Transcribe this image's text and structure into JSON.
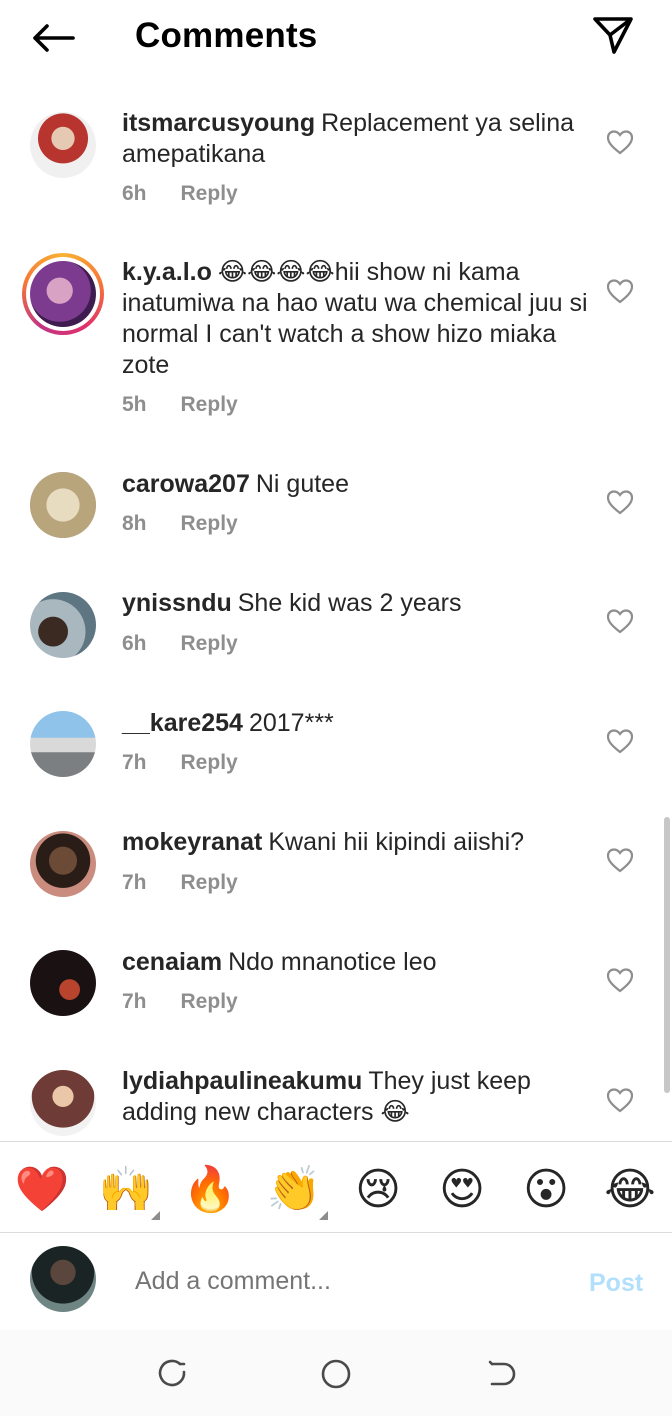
{
  "header": {
    "title": "Comments",
    "back_icon": "arrow-left-icon",
    "share_icon": "paper-plane-icon"
  },
  "comments": [
    {
      "username": "itsmarcusyoung",
      "text": "Replacement ya selina amepatikana",
      "time": "6h",
      "reply_label": "Reply",
      "avatar_color": "#9aa7b8"
    },
    {
      "username": "k.y.a.l.o",
      "text": "😂😂😂😂hii show ni kama inatumiwa na hao watu wa chemical juu si normal I can't watch a show hizo miaka zote",
      "time": "5h",
      "reply_label": "Reply",
      "avatar_color": "#8a5aa8"
    },
    {
      "username": "carowa207",
      "text": "Ni gutee",
      "time": "8h",
      "reply_label": "Reply",
      "avatar_color": "#c9b793"
    },
    {
      "username": "ynissndu",
      "text": "She kid was 2 years",
      "time": "6h",
      "reply_label": "Reply",
      "avatar_color": "#6f8a8f"
    },
    {
      "username": "__kare254",
      "text": "2017***",
      "time": "7h",
      "reply_label": "Reply",
      "avatar_color": "#7ea6c8"
    },
    {
      "username": "mokeyranat",
      "text": "Kwani hii kipindi aiishi?",
      "time": "7h",
      "reply_label": "Reply",
      "avatar_color": "#5a4638"
    },
    {
      "username": "cenaiam",
      "text": "Ndo mnanotice leo",
      "time": "7h",
      "reply_label": "Reply",
      "avatar_color": "#1a1414"
    },
    {
      "username": "lydiahpaulineakumu",
      "text": "They just keep adding  new characters 😂",
      "time": "",
      "reply_label": "",
      "avatar_color": "#7a4a44"
    }
  ],
  "emoji_bar": [
    "❤️",
    "🙌",
    "🔥",
    "👏",
    "😢",
    "😍",
    "😮",
    "😂"
  ],
  "composer": {
    "placeholder": "Add a comment...",
    "post_label": "Post",
    "avatar_color": "#2f3a3a"
  },
  "colors": {
    "text": "#262626",
    "muted": "#8e8e8e",
    "post_disabled": "#b2dffc",
    "heart_outline": "#8e8e8e"
  }
}
